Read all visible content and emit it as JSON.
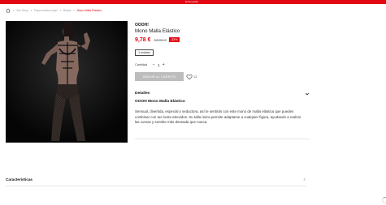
{
  "topbar": {
    "text": "Envío gratis"
  },
  "breadcrumb": {
    "items": [
      "Sex Shop",
      "Ropa erótica mujer",
      "Bodys",
      "Mono Malla Elástico"
    ]
  },
  "product": {
    "brand": "OOOH!",
    "name": "Mono Malla Elástico",
    "price": "9,78 €",
    "old_price": "13,95 €",
    "discount": "-33%",
    "variant": "1 unidad",
    "quantity_label": "Cantidad",
    "quantity": "1",
    "minus": "−",
    "plus": "+",
    "add_to_cart": "AÑADIR AL CARRITO",
    "wishlist_count": "13"
  },
  "details": {
    "title": "Detalles",
    "subtitle": "OOOH Mono Malla Elástico",
    "description": "Sensual, divertida, especial y seductora, así te sentirás con este mono de malla elástica que puedes combinar con tus looks atrevidos. Su talla única permite adaptarse a cualquier figura, ayudando a realzar las curvas y sentirte más deseada que nunca."
  },
  "features": {
    "title": "Características"
  },
  "icons": [
    "home-icon",
    "heart-icon",
    "chevron-down-icon",
    "chevron-right-icon"
  ],
  "colors": {
    "accent": "#e30613",
    "button_disabled": "#bdbdbd"
  }
}
